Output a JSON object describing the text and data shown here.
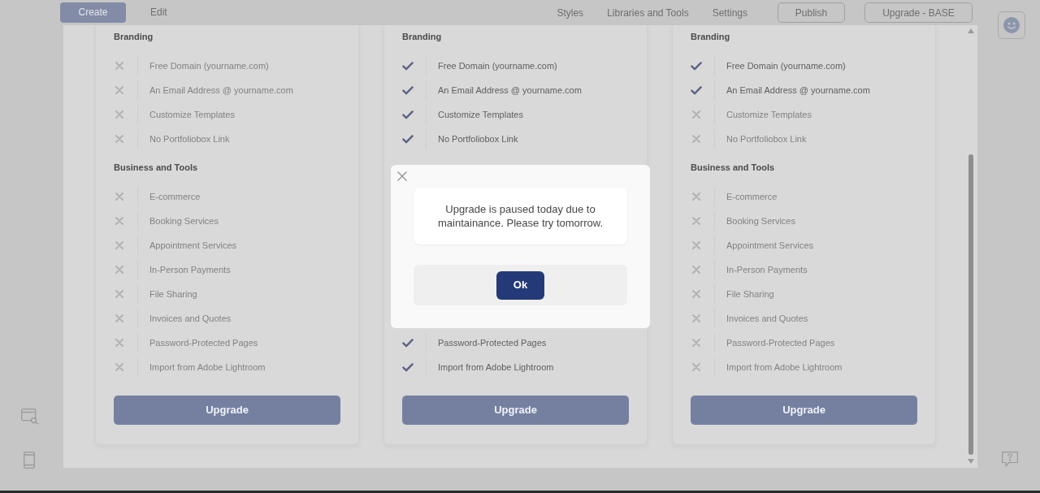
{
  "top_bar": {
    "tabs": [
      {
        "label": "Create",
        "selected": true
      },
      {
        "label": "Edit",
        "selected": false
      }
    ],
    "menu": [
      "Styles",
      "Libraries and Tools",
      "Settings"
    ],
    "buttons": [
      "Publish",
      "Upgrade - BASE"
    ]
  },
  "plans_modal": {
    "plans": [
      {
        "sections": [
          {
            "title": "Branding",
            "features": [
              {
                "label": "Free Domain (yourname.com)",
                "included": false
              },
              {
                "label": "An Email Address @ yourname.com",
                "included": false
              },
              {
                "label": "Customize Templates",
                "included": false
              },
              {
                "label": "No Portfoliobox Link",
                "included": false
              }
            ]
          },
          {
            "title": "Business and Tools",
            "features": [
              {
                "label": "E-commerce",
                "included": false
              },
              {
                "label": "Booking Services",
                "included": false
              },
              {
                "label": "Appointment Services",
                "included": false
              },
              {
                "label": "In-Person Payments",
                "included": false
              },
              {
                "label": "File Sharing",
                "included": false
              },
              {
                "label": "Invoices and Quotes",
                "included": false
              },
              {
                "label": "Password-Protected Pages",
                "included": false
              },
              {
                "label": "Import from Adobe Lightroom",
                "included": false
              }
            ]
          }
        ],
        "button": "Upgrade"
      },
      {
        "sections": [
          {
            "title": "Branding",
            "features": [
              {
                "label": "Free Domain (yourname.com)",
                "included": true
              },
              {
                "label": "An Email Address @ yourname.com",
                "included": true
              },
              {
                "label": "Customize Templates",
                "included": true
              },
              {
                "label": "No Portfoliobox Link",
                "included": true
              }
            ]
          },
          {
            "features": [
              {
                "label": "Password-Protected Pages",
                "included": true
              },
              {
                "label": "Import from Adobe Lightroom",
                "included": true
              }
            ]
          }
        ],
        "button": "Upgrade"
      },
      {
        "sections": [
          {
            "title": "Branding",
            "features": [
              {
                "label": "Free Domain (yourname.com)",
                "included": true
              },
              {
                "label": "An Email Address @ yourname.com",
                "included": true
              },
              {
                "label": "Customize Templates",
                "included": false
              },
              {
                "label": "No Portfoliobox Link",
                "included": false
              }
            ]
          },
          {
            "title": "Business and Tools",
            "features": [
              {
                "label": "E-commerce",
                "included": false
              },
              {
                "label": "Booking Services",
                "included": false
              },
              {
                "label": "Appointment Services",
                "included": false
              },
              {
                "label": "In-Person Payments",
                "included": false
              },
              {
                "label": "File Sharing",
                "included": false
              },
              {
                "label": "Invoices and Quotes",
                "included": false
              },
              {
                "label": "Password-Protected Pages",
                "included": false
              },
              {
                "label": "Import from Adobe Lightroom",
                "included": false
              }
            ]
          }
        ],
        "button": "Upgrade"
      }
    ]
  },
  "dialog": {
    "message": "Upgrade is paused today due to maintainance. Please try tomorrow.",
    "button": "Ok"
  }
}
